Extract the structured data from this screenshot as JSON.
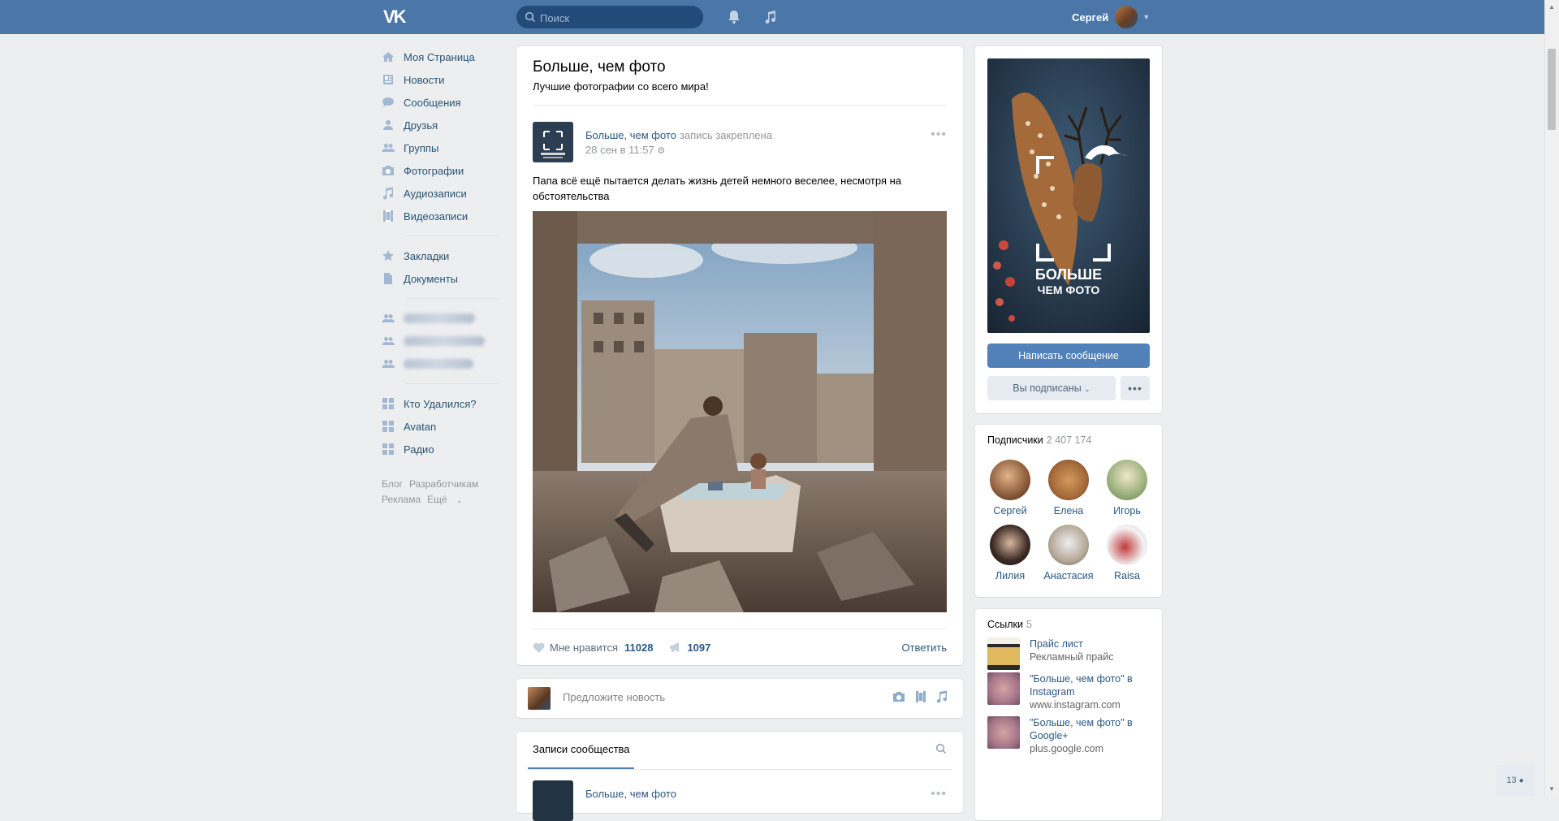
{
  "header": {
    "logo": "VK",
    "search_placeholder": "Поиск",
    "user_name": "Сергей"
  },
  "leftnav": {
    "items": [
      {
        "label": "Моя Страница",
        "icon": "home-icon"
      },
      {
        "label": "Новости",
        "icon": "news-icon"
      },
      {
        "label": "Сообщения",
        "icon": "messages-icon"
      },
      {
        "label": "Друзья",
        "icon": "friends-icon"
      },
      {
        "label": "Группы",
        "icon": "groups-icon"
      },
      {
        "label": "Фотографии",
        "icon": "camera-icon"
      },
      {
        "label": "Аудиозаписи",
        "icon": "music-icon"
      },
      {
        "label": "Видеозаписи",
        "icon": "video-icon"
      }
    ],
    "items2": [
      {
        "label": "Закладки",
        "icon": "star-icon"
      },
      {
        "label": "Документы",
        "icon": "document-icon"
      }
    ],
    "apps": [
      {
        "label": "Кто Удалился?",
        "icon": "app-grid-icon"
      },
      {
        "label": "Avatan",
        "icon": "app-grid-icon"
      },
      {
        "label": "Радио",
        "icon": "app-grid-icon"
      }
    ],
    "footer": {
      "blog": "Блог",
      "developers": "Разработчикам",
      "ads": "Реклама",
      "more": "Ещё"
    }
  },
  "community": {
    "title": "Больше, чем фото",
    "description": "Лучшие фотографии со всего мира!"
  },
  "post": {
    "author": "Больше, чем фото",
    "pinned": "запись закреплена",
    "date": "28 сен в 11:57",
    "text": "Папа всё ещё пытается делать жизнь детей немного веселее, несмотря на обстоятельства",
    "like_label": "Мне нравится",
    "likes": "11028",
    "shares": "1097",
    "reply": "Ответить"
  },
  "suggest": {
    "placeholder": "Предложите новость"
  },
  "records": {
    "tab": "Записи сообщества",
    "author": "Больше, чем фото"
  },
  "cover": {
    "line1": "БОЛЬШЕ",
    "line2": "ЧЕМ ФОТО",
    "message_button": "Написать сообщение",
    "subscribed_button": "Вы подписаны"
  },
  "subscribers": {
    "title": "Подписчики",
    "count": "2 407 174",
    "people": [
      {
        "name": "Сергей"
      },
      {
        "name": "Елена"
      },
      {
        "name": "Игорь"
      },
      {
        "name": "Лилия"
      },
      {
        "name": "Анастасия"
      },
      {
        "name": "Raisa"
      }
    ]
  },
  "links": {
    "title": "Ссылки",
    "count": "5",
    "items": [
      {
        "title": "Прайс лист",
        "subtitle": "Рекламный прайс"
      },
      {
        "title": "\"Больше, чем фото\" в Instagram",
        "subtitle": "www.instagram.com"
      },
      {
        "title": "\"Больше, чем фото\" в Google+",
        "subtitle": "plus.google.com"
      }
    ]
  },
  "online": {
    "count": "13"
  },
  "colors": {
    "header": "#4a76a8",
    "accent": "#5181b8",
    "background": "#edeef0",
    "link": "#2a5885"
  }
}
